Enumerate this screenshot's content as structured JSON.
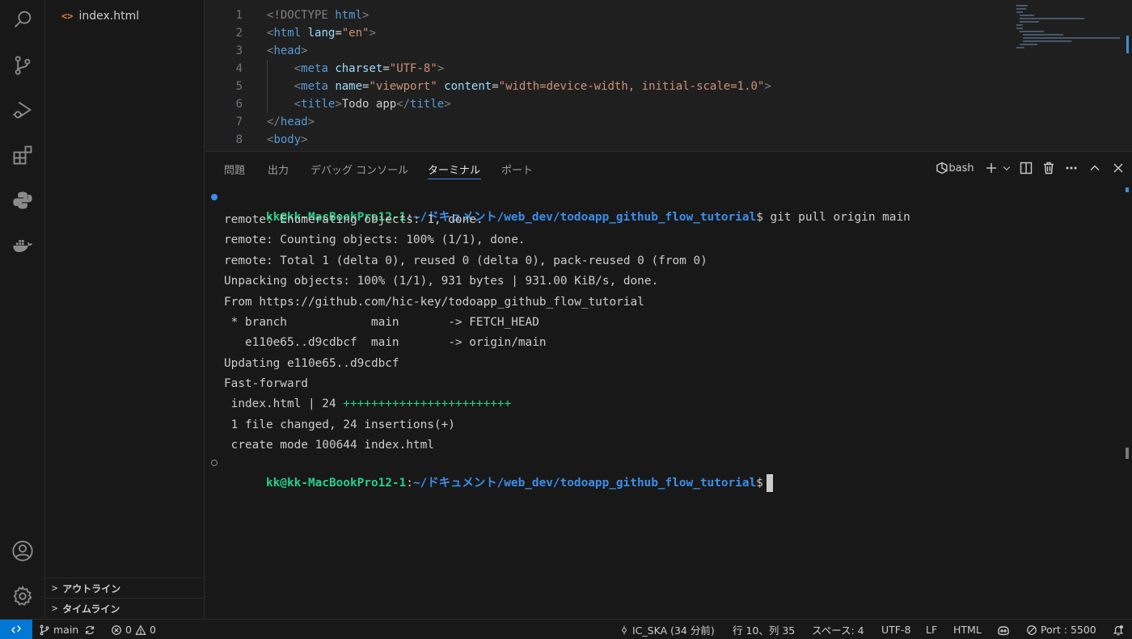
{
  "sidebar": {
    "file_name": "index.html",
    "file_icon_glyph": "<>",
    "sections": [
      {
        "label": "アウトライン"
      },
      {
        "label": "タイムライン"
      }
    ]
  },
  "editor": {
    "line_numbers": [
      "1",
      "2",
      "3",
      "4",
      "5",
      "6",
      "7",
      "8"
    ],
    "lines": [
      [
        {
          "t": "<!DOCTYPE ",
          "c": "br"
        },
        {
          "t": "html",
          "c": "tag"
        },
        {
          "t": ">",
          "c": "br"
        }
      ],
      [
        {
          "t": "<",
          "c": "br"
        },
        {
          "t": "html ",
          "c": "tag"
        },
        {
          "t": "lang",
          "c": "attr"
        },
        {
          "t": "=",
          "c": "txt"
        },
        {
          "t": "\"en\"",
          "c": "str"
        },
        {
          "t": ">",
          "c": "br"
        }
      ],
      [
        {
          "t": "<",
          "c": "br"
        },
        {
          "t": "head",
          "c": "tag"
        },
        {
          "t": ">",
          "c": "br"
        }
      ],
      [
        {
          "t": "    <",
          "c": "br"
        },
        {
          "t": "meta ",
          "c": "tag"
        },
        {
          "t": "charset",
          "c": "attr"
        },
        {
          "t": "=",
          "c": "txt"
        },
        {
          "t": "\"UTF-8\"",
          "c": "str"
        },
        {
          "t": ">",
          "c": "br"
        }
      ],
      [
        {
          "t": "    <",
          "c": "br"
        },
        {
          "t": "meta ",
          "c": "tag"
        },
        {
          "t": "name",
          "c": "attr"
        },
        {
          "t": "=",
          "c": "txt"
        },
        {
          "t": "\"viewport\" ",
          "c": "str"
        },
        {
          "t": "content",
          "c": "attr"
        },
        {
          "t": "=",
          "c": "txt"
        },
        {
          "t": "\"width=device-width, initial-scale=1.0\"",
          "c": "str"
        },
        {
          "t": ">",
          "c": "br"
        }
      ],
      [
        {
          "t": "    <",
          "c": "br"
        },
        {
          "t": "title",
          "c": "tag"
        },
        {
          "t": ">",
          "c": "br"
        },
        {
          "t": "Todo app",
          "c": "txt"
        },
        {
          "t": "</",
          "c": "br"
        },
        {
          "t": "title",
          "c": "tag"
        },
        {
          "t": ">",
          "c": "br"
        }
      ],
      [
        {
          "t": "</",
          "c": "br"
        },
        {
          "t": "head",
          "c": "tag"
        },
        {
          "t": ">",
          "c": "br"
        }
      ],
      [
        {
          "t": "<",
          "c": "br"
        },
        {
          "t": "body",
          "c": "tag"
        },
        {
          "t": ">",
          "c": "br"
        }
      ]
    ]
  },
  "panel": {
    "tabs": [
      {
        "label": "問題"
      },
      {
        "label": "出力"
      },
      {
        "label": "デバッグ コンソール"
      },
      {
        "label": "ターミナル",
        "active": true
      },
      {
        "label": "ポート"
      }
    ],
    "shell_label": "bash"
  },
  "terminal": {
    "prompt_user": "kk@kk-MacBookPro12-1",
    "prompt_path": "~/ドキュメント/web_dev/todoapp_github_flow_tutorial",
    "command": " git pull origin main",
    "output": [
      "remote: Enumerating objects: 1, done.",
      "remote: Counting objects: 100% (1/1), done.",
      "remote: Total 1 (delta 0), reused 0 (delta 0), pack-reused 0 (from 0)",
      "Unpacking objects: 100% (1/1), 931 bytes | 931.00 KiB/s, done.",
      "From https://github.com/hic-key/todoapp_github_flow_tutorial",
      " * branch            main       -> FETCH_HEAD",
      "   e110e65..d9cdbcf  main       -> origin/main",
      "Updating e110e65..d9cdbcf",
      "Fast-forward"
    ],
    "diffstat_file": " index.html | 24 ",
    "diffstat_plus": "++++++++++++++++++++++++",
    "summary": [
      " 1 file changed, 24 insertions(+)",
      " create mode 100644 index.html"
    ]
  },
  "statusbar": {
    "branch": "main",
    "errors": "0",
    "warnings": "0",
    "commit_info": "IC_SKA (34 分前)",
    "cursor_pos": "行 10、列 35",
    "indent": "スペース: 4",
    "encoding": "UTF-8",
    "eol": "LF",
    "language": "HTML",
    "port": "Port : 5500"
  },
  "colors": {
    "accent": "#0078d4",
    "prompt_user": "#23d18b",
    "prompt_path": "#3b8eea"
  }
}
